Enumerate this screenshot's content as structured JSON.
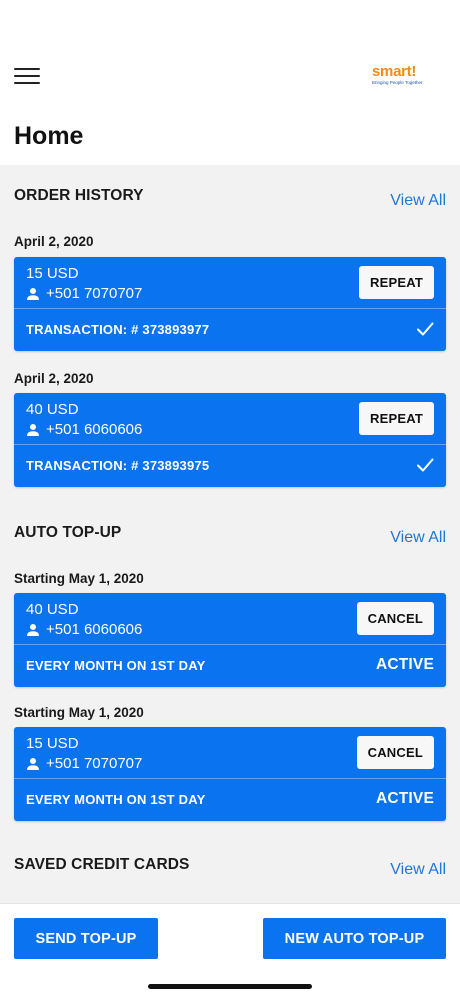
{
  "header": {
    "title": "Home",
    "logo_text": "smart",
    "logo_bang": "!",
    "logo_tagline": "Bringing People Together"
  },
  "colors": {
    "brand_blue": "#0a73ef",
    "link_blue": "#1e78d8",
    "logo_orange": "#f0891f",
    "background_gray": "#f2f2f2"
  },
  "order_history": {
    "title": "ORDER HISTORY",
    "view_all": "View All",
    "orders": [
      {
        "date": "April 2, 2020",
        "amount": "15 USD",
        "phone": "+501 7070707",
        "button": "REPEAT",
        "transaction": "TRANSACTION: # 373893977",
        "status_icon": "check-icon"
      },
      {
        "date": "April 2, 2020",
        "amount": "40 USD",
        "phone": "+501 6060606",
        "button": "REPEAT",
        "transaction": "TRANSACTION: # 373893975",
        "status_icon": "check-icon"
      }
    ]
  },
  "auto_topup": {
    "title": "AUTO TOP-UP",
    "view_all": "View All",
    "items": [
      {
        "date": "Starting May 1, 2020",
        "amount": "40 USD",
        "phone": "+501 6060606",
        "button": "CANCEL",
        "schedule": "EVERY MONTH ON 1ST DAY",
        "status": "ACTIVE"
      },
      {
        "date": "Starting May 1, 2020",
        "amount": "15 USD",
        "phone": "+501 7070707",
        "button": "CANCEL",
        "schedule": "EVERY MONTH ON 1ST DAY",
        "status": "ACTIVE"
      }
    ]
  },
  "saved_cards": {
    "title": "SAVED CREDIT CARDS",
    "view_all": "View All"
  },
  "footer": {
    "send_topup": "SEND TOP-UP",
    "new_auto_topup": "NEW AUTO TOP-UP"
  }
}
